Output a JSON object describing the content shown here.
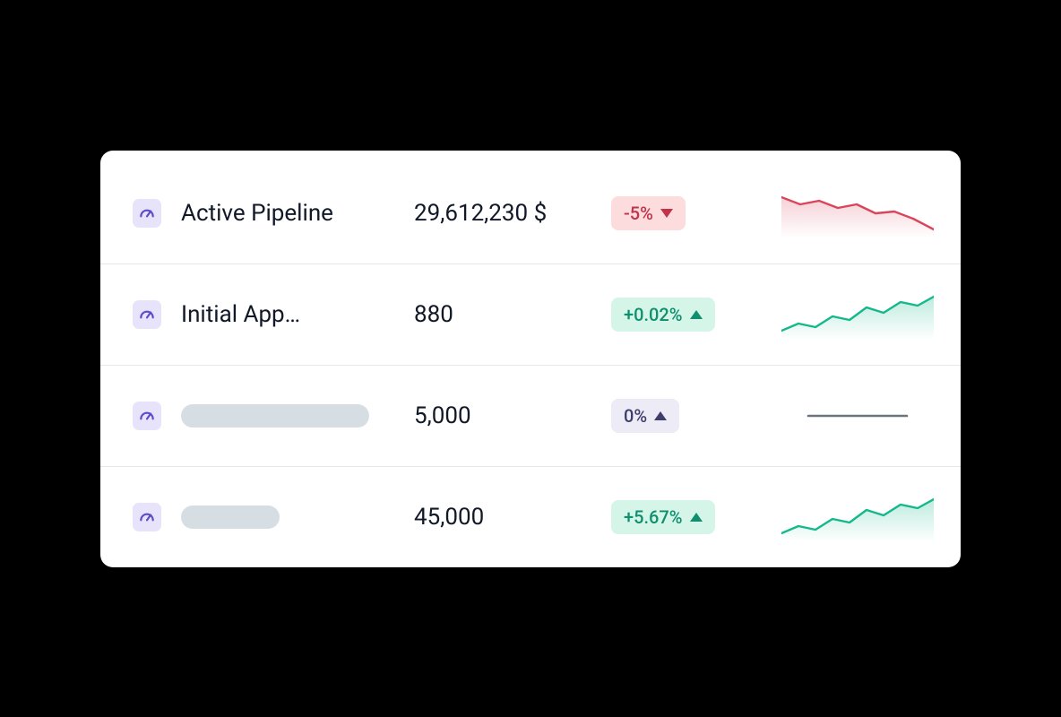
{
  "metrics": [
    {
      "label": "Active Pipeline",
      "placeholder": null,
      "value": "29,612,230 $",
      "change": "-5%",
      "direction": "down",
      "trend": "down"
    },
    {
      "label": "Initial App…",
      "placeholder": null,
      "value": "880",
      "change": "+0.02%",
      "direction": "up",
      "trend": "up"
    },
    {
      "label": null,
      "placeholder": "wide",
      "value": "5,000",
      "change": "0%",
      "direction": "flat",
      "trend": "flat"
    },
    {
      "label": null,
      "placeholder": "narrow",
      "value": "45,000",
      "change": "+5.67%",
      "direction": "up",
      "trend": "up"
    }
  ],
  "icon_name": "gauge-icon",
  "colors": {
    "up": "#14b88a",
    "down": "#d9455a",
    "flat": "#6b7280"
  },
  "chart_data": [
    {
      "type": "line",
      "values": [
        50,
        42,
        46,
        40,
        44,
        36,
        38,
        30,
        20
      ],
      "color": "down"
    },
    {
      "type": "line",
      "values": [
        8,
        16,
        12,
        22,
        18,
        30,
        24,
        36,
        32,
        40
      ],
      "color": "up"
    },
    {
      "type": "line",
      "values": [
        28,
        28,
        28,
        28,
        28,
        28,
        28,
        28,
        28,
        28
      ],
      "color": "flat"
    },
    {
      "type": "line",
      "values": [
        8,
        16,
        12,
        22,
        18,
        30,
        24,
        36,
        32,
        40
      ],
      "color": "up"
    }
  ]
}
